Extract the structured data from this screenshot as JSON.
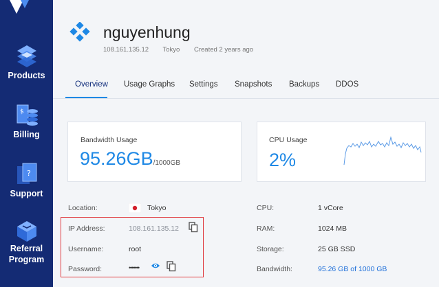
{
  "sidebar": {
    "items": [
      {
        "label": "Products",
        "icon": "products-icon"
      },
      {
        "label": "Billing",
        "icon": "billing-icon"
      },
      {
        "label": "Support",
        "icon": "support-icon"
      },
      {
        "label": "Referral",
        "label2": "Program",
        "icon": "referral-icon"
      }
    ]
  },
  "server": {
    "name": "nguyenhung",
    "ip": "108.161.135.12",
    "location": "Tokyo",
    "created": "Created 2 years ago"
  },
  "tabs": [
    "Overview",
    "Usage Graphs",
    "Settings",
    "Snapshots",
    "Backups",
    "DDOS"
  ],
  "active_tab": "Overview",
  "bandwidth_card": {
    "title": "Bandwidth Usage",
    "value": "95.26GB",
    "unit": "/1000GB"
  },
  "cpu_card": {
    "title": "CPU Usage",
    "value": "2%"
  },
  "details_left": [
    {
      "label": "Location:",
      "value": "Tokyo"
    },
    {
      "label": "IP Address:",
      "value": "108.161.135.12"
    },
    {
      "label": "Username:",
      "value": "root"
    },
    {
      "label": "Password:",
      "value": "•••••••"
    }
  ],
  "details_right": [
    {
      "label": "CPU:",
      "value": "1 vCore"
    },
    {
      "label": "RAM:",
      "value": "1024 MB"
    },
    {
      "label": "Storage:",
      "value": "25 GB SSD"
    },
    {
      "label": "Bandwidth:",
      "value": "95.26 GB of 1000 GB"
    }
  ],
  "colors": {
    "sidebar": "#142b74",
    "accent": "#1e88e5",
    "highlight": "#e0393e"
  }
}
